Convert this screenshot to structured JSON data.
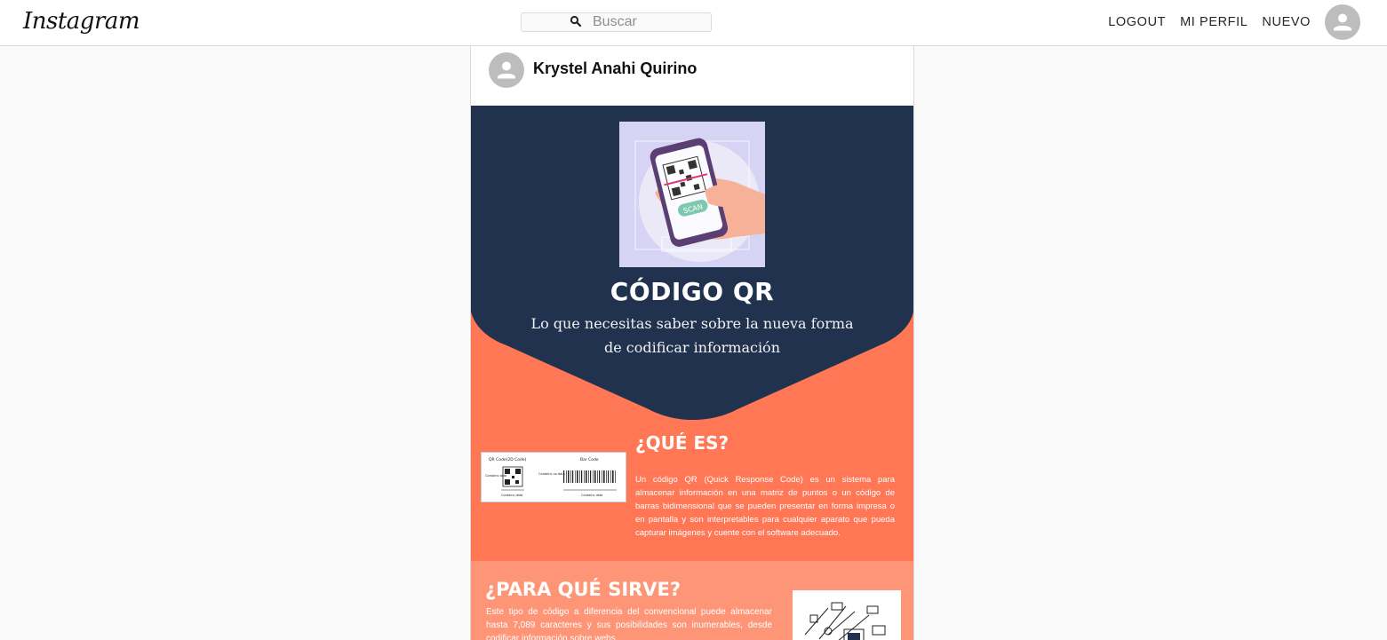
{
  "nav": {
    "logo": "Instagram",
    "search_placeholder": "Buscar",
    "search_value": "",
    "links": [
      "LOGOUT",
      "MI PERFIL",
      "NUEVO"
    ]
  },
  "post": {
    "username": "Krystel Anahi Quirino",
    "infographic": {
      "title": "CÓDIGO QR",
      "subtitle": "Lo que necesitas saber sobre la nueva forma de codificar información",
      "section1": {
        "title": "¿QUÉ ES?",
        "text": "Un código QR (Quick Response Code) es un sistema para almacenar información en una matriz de puntos o un código de barras bidimensional que se pueden presentar en forma impresa o en pantalla y son interpretables para cualquier aparato que pueda capturar imágenes y cuente con el software adecuado.",
        "image": {
          "qr_label": "QR Code(2D Code)",
          "bar_label": "Bar Code",
          "contains_data": "Contains data",
          "contains_no_data": "Contains no data"
        }
      },
      "section2": {
        "title": "¿PARA QUÉ SIRVE?",
        "text": "Este tipo de código a diferencia del convencional puede almacenar hasta 7,089 caracteres y sus posibilidades son inumerables, desde codificar información sobre webs,"
      },
      "hero_badge": "SCAN"
    }
  },
  "colors": {
    "navy": "#21324f",
    "coral": "#ff7755",
    "coral_light": "#ff9577",
    "lavender": "#d6d3f5"
  }
}
